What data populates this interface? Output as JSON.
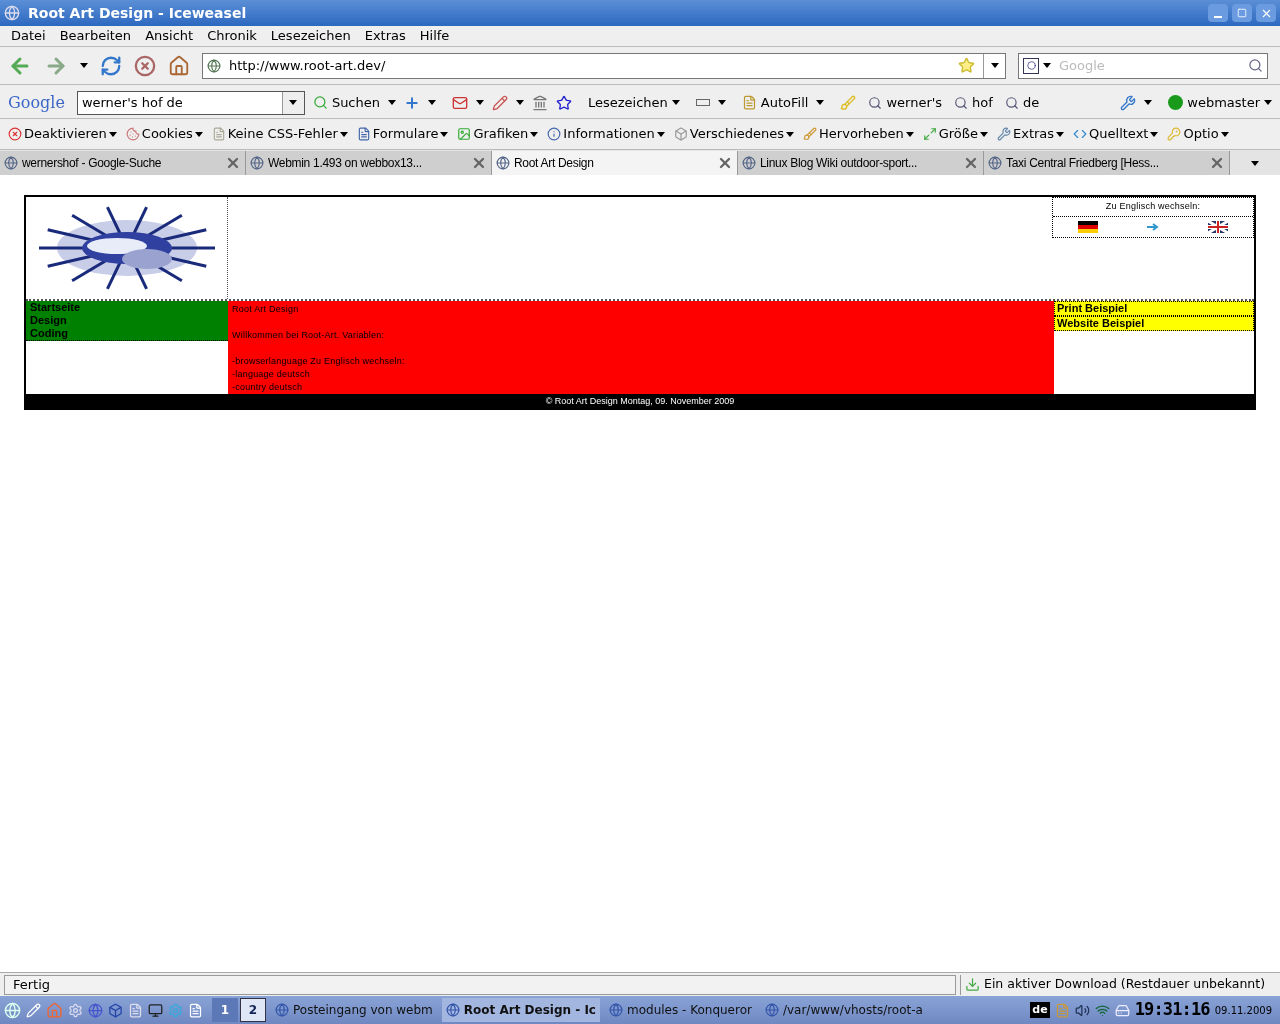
{
  "window": {
    "title": "Root Art Design - Iceweasel"
  },
  "menu": [
    {
      "label": "Datei"
    },
    {
      "label": "Bearbeiten"
    },
    {
      "label": "Ansicht"
    },
    {
      "label": "Chronik"
    },
    {
      "label": "Lesezeichen"
    },
    {
      "label": "Extras"
    },
    {
      "label": "Hilfe"
    }
  ],
  "navigation": {
    "url": "http://www.root-art.dev/",
    "search_placeholder": "Google"
  },
  "google_toolbar": {
    "logo": "Google",
    "query": "werner's hof de",
    "items": [
      {
        "kind": "search",
        "label": "Suchen"
      },
      {
        "kind": "bookmarks",
        "label": "Lesezeichen"
      },
      {
        "kind": "autofill",
        "label": "AutoFill"
      },
      {
        "kind": "term",
        "label": "werner's"
      },
      {
        "kind": "term",
        "label": "hof"
      },
      {
        "kind": "term",
        "label": "de"
      }
    ],
    "account": "webmaster"
  },
  "developer_toolbar": [
    {
      "label": "Deaktivieren"
    },
    {
      "label": "Cookies"
    },
    {
      "label": "Keine CSS-Fehler"
    },
    {
      "label": "Formulare"
    },
    {
      "label": "Grafiken"
    },
    {
      "label": "Informationen"
    },
    {
      "label": "Verschiedenes"
    },
    {
      "label": "Hervorheben"
    },
    {
      "label": "Größe"
    },
    {
      "label": "Extras"
    },
    {
      "label": "Quelltext"
    },
    {
      "label": "Optio"
    }
  ],
  "tabs": [
    {
      "label": "wernershof - Google-Suche",
      "selected": false
    },
    {
      "label": "Webmin 1.493 on webbox13...",
      "selected": false
    },
    {
      "label": "Root Art Design",
      "selected": true
    },
    {
      "label": "Linux Blog Wiki outdoor-sport...",
      "selected": false
    },
    {
      "label": "Taxi Central Friedberg [Hess...",
      "selected": false
    }
  ],
  "page": {
    "language_switch": "Zu Englisch wechseln:",
    "nav": [
      {
        "label": "Startseite"
      },
      {
        "label": "Design"
      },
      {
        "label": "Coding"
      }
    ],
    "content": [
      [
        "Root Art Design"
      ],
      [
        "Willkommen bei Root-Art. Variablen:"
      ],
      [
        "-browserlanguage Zu Englisch wechseln:",
        "-language deutsch",
        "-country deutsch"
      ]
    ],
    "links": [
      {
        "label": "Print Beispiel"
      },
      {
        "label": "Website Beispiel"
      }
    ],
    "footer": "© Root Art Design Montag, 09. November 2009"
  },
  "status_bar": {
    "text": "Fertig",
    "download": "Ein aktiver Download (Restdauer unbekannt)"
  },
  "taskbar": {
    "desktops": [
      {
        "label": "1",
        "selected": false
      },
      {
        "label": "2",
        "selected": true
      }
    ],
    "tasks": [
      {
        "label": "Posteingang von webm",
        "selected": false
      },
      {
        "label": "Root Art Design - Ic",
        "selected": true
      },
      {
        "label": "modules - Konqueror",
        "selected": false
      },
      {
        "label": "/var/www/vhosts/root-a",
        "selected": false
      }
    ],
    "keyboard": "de",
    "clock": "19:31:16",
    "date": "09.11.2009"
  }
}
